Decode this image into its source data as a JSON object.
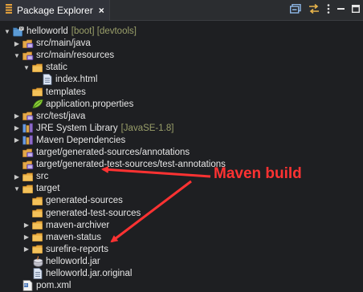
{
  "panel": {
    "tab_title": "Package Explorer",
    "close_glyph": "×",
    "toolbar": [
      {
        "name": "collapse-all-icon"
      },
      {
        "name": "link-with-editor-icon"
      },
      {
        "name": "view-menu-icon"
      },
      {
        "name": "minimize-icon"
      },
      {
        "name": "maximize-icon"
      }
    ]
  },
  "tree": [
    {
      "label": "helloworld",
      "decoration": "[boot] [devtools]",
      "indent": 0,
      "twisty": "open",
      "icon": "project"
    },
    {
      "label": "src/main/java",
      "indent": 1,
      "twisty": "closed",
      "icon": "srcfolder"
    },
    {
      "label": "src/main/resources",
      "indent": 1,
      "twisty": "open",
      "icon": "srcfolder"
    },
    {
      "label": "static",
      "indent": 2,
      "twisty": "open",
      "icon": "folder"
    },
    {
      "label": "index.html",
      "indent": 3,
      "twisty": "none",
      "icon": "file"
    },
    {
      "label": "templates",
      "indent": 2,
      "twisty": "none",
      "icon": "folder"
    },
    {
      "label": "application.properties",
      "indent": 2,
      "twisty": "none",
      "icon": "properties"
    },
    {
      "label": "src/test/java",
      "indent": 1,
      "twisty": "closed",
      "icon": "srcfolder"
    },
    {
      "label": "JRE System Library",
      "decoration": "[JavaSE-1.8]",
      "indent": 1,
      "twisty": "closed",
      "icon": "library"
    },
    {
      "label": "Maven Dependencies",
      "indent": 1,
      "twisty": "closed",
      "icon": "library"
    },
    {
      "label": "target/generated-sources/annotations",
      "indent": 1,
      "twisty": "none",
      "icon": "srcfolder"
    },
    {
      "label": "target/generated-test-sources/test-annotations",
      "indent": 1,
      "twisty": "none",
      "icon": "srcfolder"
    },
    {
      "label": "src",
      "indent": 1,
      "twisty": "closed",
      "icon": "folder"
    },
    {
      "label": "target",
      "indent": 1,
      "twisty": "open",
      "icon": "folder"
    },
    {
      "label": "generated-sources",
      "indent": 2,
      "twisty": "none",
      "icon": "folder"
    },
    {
      "label": "generated-test-sources",
      "indent": 2,
      "twisty": "none",
      "icon": "folder"
    },
    {
      "label": "maven-archiver",
      "indent": 2,
      "twisty": "closed",
      "icon": "folder"
    },
    {
      "label": "maven-status",
      "indent": 2,
      "twisty": "closed",
      "icon": "folder"
    },
    {
      "label": "surefire-reports",
      "indent": 2,
      "twisty": "closed",
      "icon": "folder"
    },
    {
      "label": "helloworld.jar",
      "indent": 2,
      "twisty": "none",
      "icon": "jar"
    },
    {
      "label": "helloworld.jar.original",
      "indent": 2,
      "twisty": "none",
      "icon": "file"
    },
    {
      "label": "pom.xml",
      "indent": 1,
      "twisty": "none",
      "icon": "xml"
    }
  ],
  "annotation": {
    "text": "Maven build",
    "color": "#ff3232"
  }
}
